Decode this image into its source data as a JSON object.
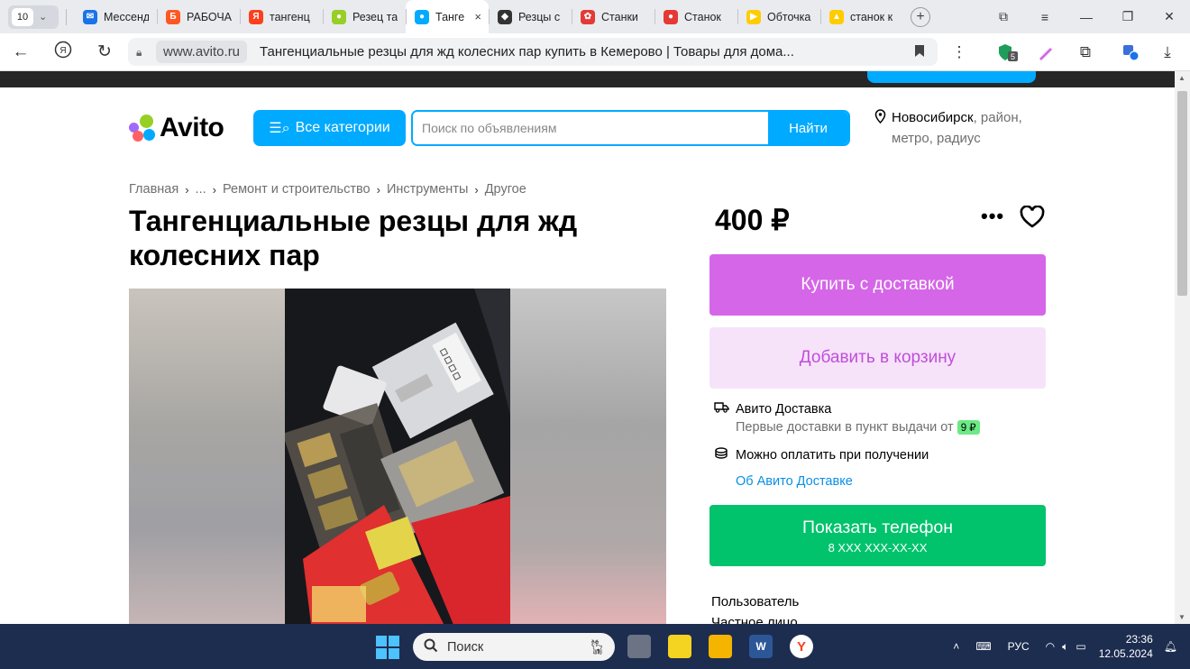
{
  "browser": {
    "tab_count": "10",
    "tabs": [
      {
        "title": "Мессенд",
        "color": "#1a73e8",
        "glyph": "✉"
      },
      {
        "title": "РАБОЧА",
        "color": "#ff5722",
        "glyph": "Б"
      },
      {
        "title": "тангенц",
        "color": "#fc3f1d",
        "glyph": "Я"
      },
      {
        "title": "Резец та",
        "color": "#97cf26",
        "glyph": "●"
      },
      {
        "title": "Танге",
        "color": "#00aaff",
        "glyph": "●",
        "active": true
      },
      {
        "title": "Резцы с",
        "color": "#333333",
        "glyph": "◆"
      },
      {
        "title": "Станки",
        "color": "#e53935",
        "glyph": "✿"
      },
      {
        "title": "Станок",
        "color": "#e53935",
        "glyph": "●"
      },
      {
        "title": "Обточка",
        "color": "#ffcc00",
        "glyph": "▶"
      },
      {
        "title": "станок к",
        "color": "#ffcc00",
        "glyph": "▲"
      }
    ],
    "close_tab": "×",
    "new_tab": "+",
    "domain": "www.avito.ru",
    "page_title": "Тангенциальные резцы для жд колесних пар купить в Кемерово | Товары для дома...",
    "extension_badge": "5"
  },
  "header": {
    "logo_text": "Avito",
    "categories_label": "Все категории",
    "search_placeholder": "Поиск по объявлениям",
    "search_button": "Найти",
    "location_city": "Новосибирск",
    "location_rest_1": ", район,",
    "location_rest_2": "метро, радиус"
  },
  "breadcrumb": [
    "Главная",
    "...",
    "Ремонт и строительство",
    "Инструменты",
    "Другое"
  ],
  "listing": {
    "title": "Тангенциальные резцы для жд колесних пар",
    "price": "400 ₽",
    "more": "•••",
    "buy_button": "Купить с доставкой",
    "cart_button": "Добавить в корзину",
    "delivery_title": "Авито Доставка",
    "delivery_sub": "Первые доставки в пункт выдачи от",
    "delivery_price": "9 ₽",
    "pay_on_receipt": "Можно оплатить при получении",
    "about_delivery": "Об Авито Доставке",
    "phone_button": "Показать телефон",
    "phone_masked": "8 XXX XXX-XX-XX",
    "seller_label": "Пользователь",
    "seller_type": "Частное лицо"
  },
  "taskbar": {
    "search_label": "Поиск",
    "lang": "РУС",
    "time": "23:36",
    "date": "12.05.2024"
  },
  "colors": {
    "avito_blue": "#00aaff",
    "buy": "#d566e8",
    "cart_bg": "#f6e3fa",
    "phone": "#00c36c"
  }
}
